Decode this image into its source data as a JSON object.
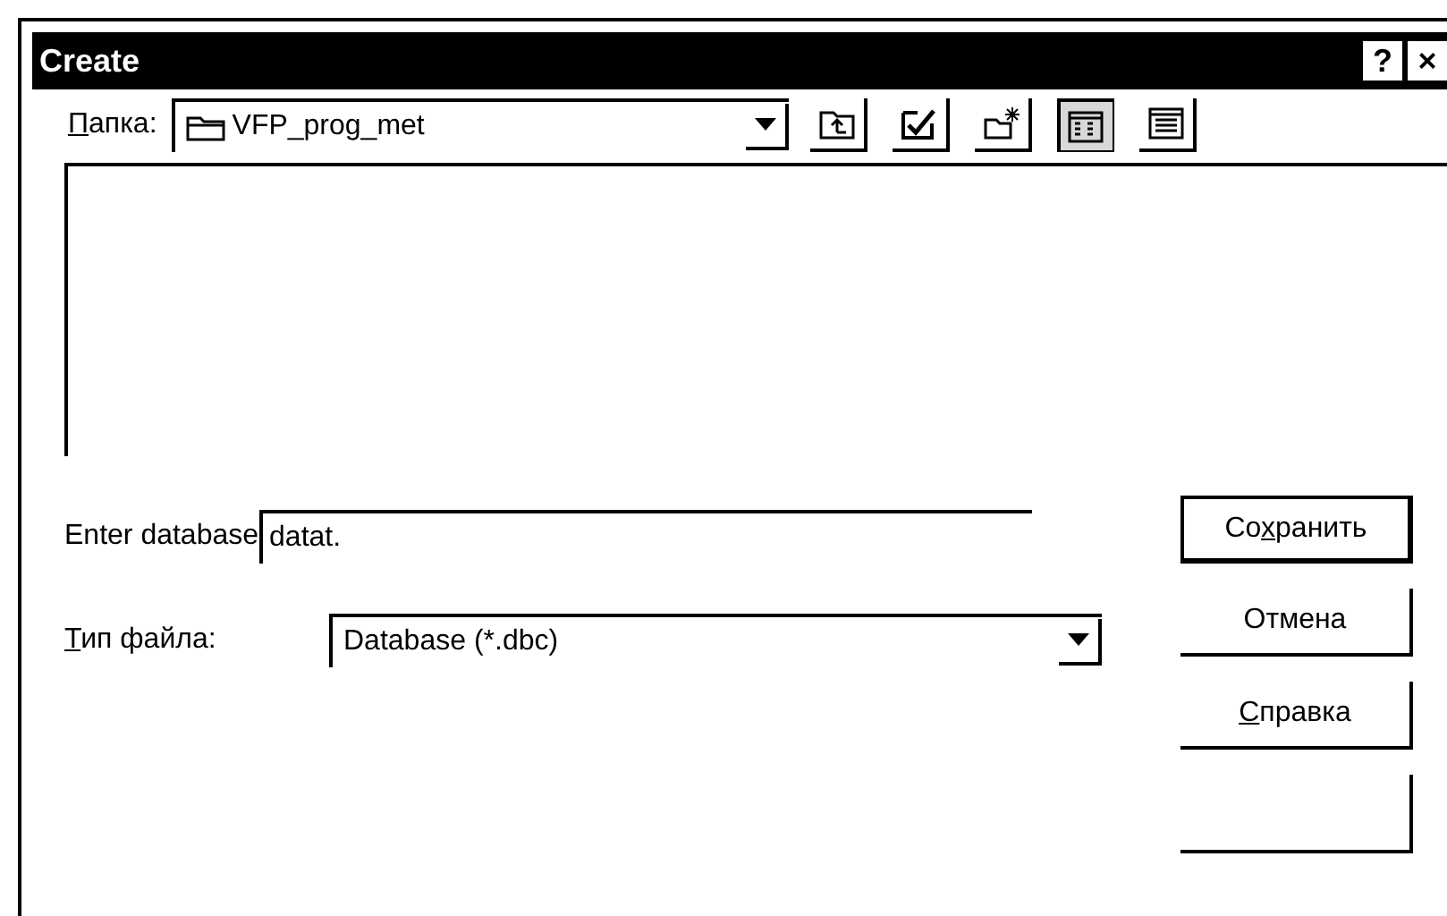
{
  "window": {
    "title": "Create",
    "title_buttons": [
      "?",
      "×"
    ]
  },
  "folder": {
    "label": {
      "accel": "П",
      "after": "апка:"
    },
    "value": "VFP_prog_met"
  },
  "toolbar": [
    {
      "kind": "up"
    },
    {
      "kind": "edit"
    },
    {
      "kind": "newfolder"
    },
    {
      "kind": "list",
      "selected": true
    },
    {
      "kind": "details",
      "selected": false
    }
  ],
  "name_field": {
    "label": "Enter database",
    "value": "datat."
  },
  "type_field": {
    "label": {
      "accel": "Т",
      "after": "ип файла:"
    },
    "value": "Database (*.dbc)"
  },
  "buttons": [
    {
      "kind": "default",
      "label": {
        "before": "Со",
        "accel": "х",
        "after": "ранить"
      }
    },
    {
      "kind": "normal",
      "label": {
        "before": "Отмена"
      }
    },
    {
      "kind": "normal",
      "label": {
        "accel": "С",
        "after": "правка"
      }
    },
    {
      "kind": "blank"
    }
  ]
}
